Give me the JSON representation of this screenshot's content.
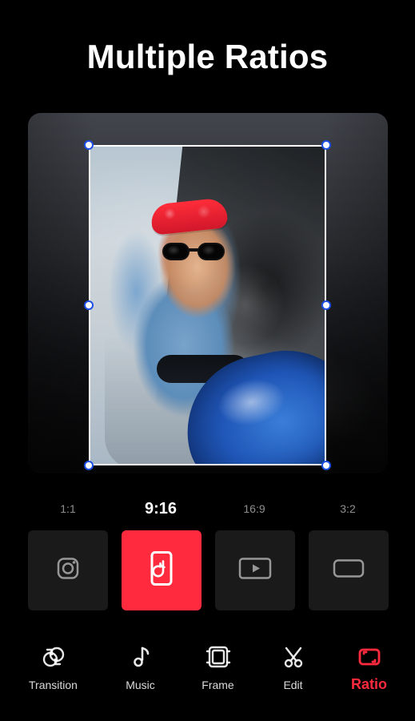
{
  "header": {
    "title": "Multiple Ratios"
  },
  "ratios": {
    "selected": "9:16",
    "items": [
      {
        "label": "1:1",
        "icon": "instagram-icon"
      },
      {
        "label": "9:16",
        "icon": "tiktok-icon"
      },
      {
        "label": "16:9",
        "icon": "youtube-icon"
      },
      {
        "label": "3:2",
        "icon": "rectangle-icon"
      }
    ]
  },
  "toolbar": {
    "items": [
      {
        "label": "Transition",
        "icon": "transition-icon"
      },
      {
        "label": "Music",
        "icon": "music-icon"
      },
      {
        "label": "Frame",
        "icon": "frame-icon"
      },
      {
        "label": "Edit",
        "icon": "scissors-icon"
      },
      {
        "label": "Ratio",
        "icon": "ratio-icon"
      }
    ],
    "active": "Ratio"
  },
  "colors": {
    "accent": "#FF2A3D",
    "background": "#000000",
    "tile_bg": "#1A1A1A",
    "handle_stroke": "#1D4FE6"
  }
}
